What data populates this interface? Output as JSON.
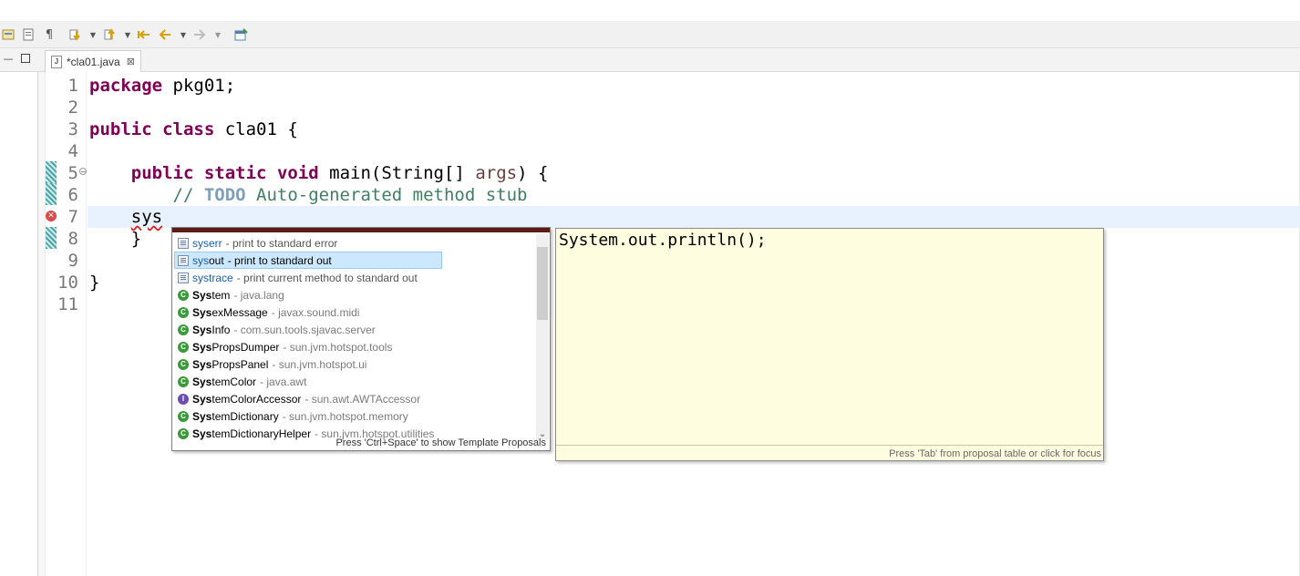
{
  "editor": {
    "tab_title": "*cla01.java",
    "line_numbers": [
      "1",
      "2",
      "3",
      "4",
      "5",
      "6",
      "7",
      "8",
      "9",
      "10",
      "11"
    ],
    "code": {
      "l1_kw": "package",
      "l1_rest": " pkg01;",
      "l3_kw1": "public",
      "l3_kw2": "class",
      "l3_rest": " cla01 {",
      "l5_kw1": "public",
      "l5_kw2": "static",
      "l5_kw3": "void",
      "l5_rest1": " main(String[] ",
      "l5_arg": "args",
      "l5_rest2": ") {",
      "l6_c1": "// ",
      "l6_todo": "TODO",
      "l6_c2": " Auto-generated method stub",
      "l7_text": "sys",
      "l8_text": "}",
      "l10_text": "}"
    }
  },
  "autocomplete": {
    "items": [
      {
        "match": "sys",
        "rest": "err",
        "desc": "- print to standard error",
        "icon": "template-icon"
      },
      {
        "match": "sys",
        "rest": "out",
        "desc": "- print to standard out",
        "icon": "template-icon",
        "selected": true
      },
      {
        "match": "sys",
        "rest": "trace",
        "desc": "- print current method to standard out",
        "icon": "template-icon"
      },
      {
        "match": "Sys",
        "rest": "tem",
        "desc": "- java.lang",
        "icon": "class-icon"
      },
      {
        "match": "Sys",
        "rest": "exMessage",
        "desc": "- javax.sound.midi",
        "icon": "class-icon"
      },
      {
        "match": "Sys",
        "rest": "Info",
        "desc": "- com.sun.tools.sjavac.server",
        "icon": "class-icon"
      },
      {
        "match": "Sys",
        "rest": "PropsDumper",
        "desc": "- sun.jvm.hotspot.tools",
        "icon": "class-icon"
      },
      {
        "match": "Sys",
        "rest": "PropsPanel",
        "desc": "- sun.jvm.hotspot.ui",
        "icon": "class-icon"
      },
      {
        "match": "Sys",
        "rest": "temColor",
        "desc": "- java.awt",
        "icon": "class-icon"
      },
      {
        "match": "Sys",
        "rest": "temColorAccessor",
        "desc": "- sun.awt.AWTAccessor",
        "icon": "interface-icon"
      },
      {
        "match": "Sys",
        "rest": "temDictionary",
        "desc": "- sun.jvm.hotspot.memory",
        "icon": "class-icon"
      },
      {
        "match": "Sys",
        "rest": "temDictionaryHelper",
        "desc": "- sun.jvm.hotspot.utilities",
        "icon": "class-icon"
      }
    ],
    "footer": "Press 'Ctrl+Space' to show Template Proposals"
  },
  "detail": {
    "text": "System.out.println();",
    "footer": "Press 'Tab' from proposal table or click for focus"
  }
}
